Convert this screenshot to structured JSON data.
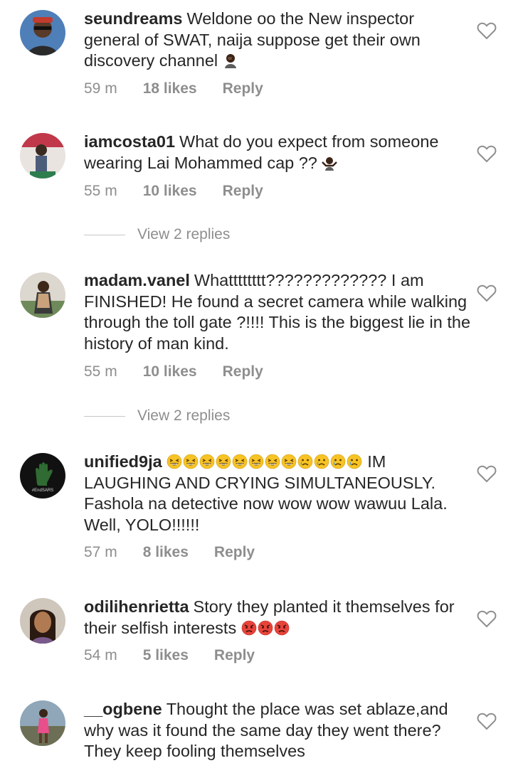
{
  "comments": [
    {
      "username": "seundreams",
      "text": "Weldone oo the New inspector general of SWAT, naija suppose get their own discovery channel",
      "emoji": "man-facepalming",
      "time": "59 m",
      "likes": "18 likes",
      "reply": "Reply"
    },
    {
      "username": "iamcosta01",
      "text": "What do you expect from someone wearing Lai Mohammed cap ??",
      "emoji": "man-shrugging",
      "time": "55 m",
      "likes": "10 likes",
      "reply": "Reply",
      "view_replies": "View 2 replies"
    },
    {
      "username": "madam.vanel",
      "text": "Whatttttttt????????????? I am FINISHED!  He found a secret camera while walking through the toll gate ?!!!! This is the biggest lie in the history of man kind.",
      "time": "55 m",
      "likes": "10 likes",
      "reply": "Reply",
      "view_replies": "View 2 replies"
    },
    {
      "username": "unified9ja",
      "text_after_emoji": "IM LAUGHING AND CRYING SIMULTANEOUSLY. Fashola na detective now wow wow wawuu Lala. Well, YOLO!!!!!!",
      "emojis": [
        "grinning-squinting-face",
        "grinning-squinting-face",
        "grinning-squinting-face",
        "grinning-squinting-face",
        "grinning-squinting-face",
        "grinning-squinting-face",
        "grinning-squinting-face",
        "grinning-squinting-face",
        "crying-face",
        "crying-face",
        "crying-face",
        "crying-face"
      ],
      "time": "57 m",
      "likes": "8 likes",
      "reply": "Reply"
    },
    {
      "username": "odilihenrietta",
      "text": "Story they planted it themselves for their selfish interests",
      "emojis": [
        "pouting-face",
        "pouting-face",
        "pouting-face"
      ],
      "time": "54 m",
      "likes": "5 likes",
      "reply": "Reply"
    },
    {
      "username": "__ogbene",
      "text": "Thought the place was set ablaze,and why was it found the same day they went there? They keep fooling themselves"
    }
  ],
  "icons": {
    "like": "heart-outline-icon"
  },
  "colors": {
    "text": "#262626",
    "muted": "#8e8e8e",
    "divider": "#c7c7c7"
  }
}
